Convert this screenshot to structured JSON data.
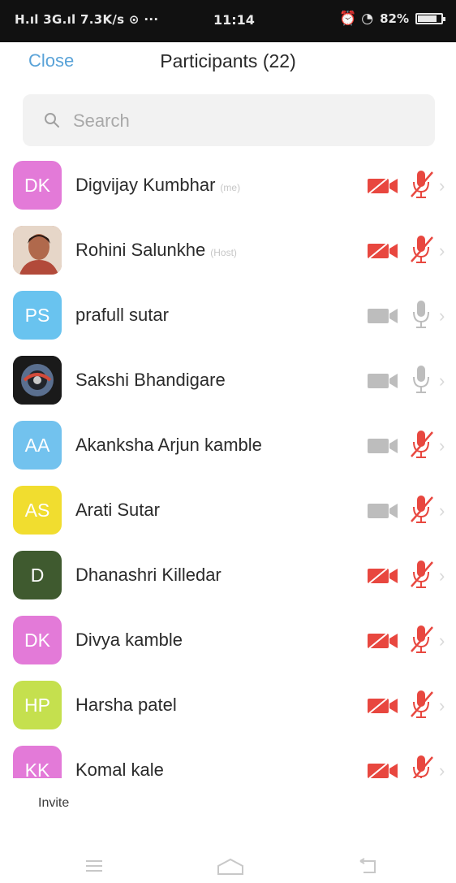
{
  "status_bar": {
    "left": "H.ıl 3G.ıl 7.3K/s ⊙ ···",
    "time": "11:14",
    "battery_text": "82%",
    "battery_level": 0.82
  },
  "header": {
    "close_label": "Close",
    "title": "Participants (22)"
  },
  "search": {
    "placeholder": "Search"
  },
  "participants": [
    {
      "initials": "DK",
      "name": "Digvijay Kumbhar",
      "role": "(me)",
      "avatar_color": "#e37ad8",
      "photo": false,
      "video": "off",
      "audio": "muted"
    },
    {
      "initials": "",
      "name": "Rohini Salunkhe",
      "role": "(Host)",
      "avatar_color": "#c9836b",
      "photo": true,
      "photo_kind": "portrait",
      "video": "off",
      "audio": "muted"
    },
    {
      "initials": "PS",
      "name": "prafull sutar",
      "role": "",
      "avatar_color": "#69c3ef",
      "photo": false,
      "video": "none",
      "audio": "none"
    },
    {
      "initials": "",
      "name": "Sakshi Bhandigare",
      "role": "",
      "avatar_color": "#1d1d1d",
      "photo": true,
      "photo_kind": "logo",
      "video": "none",
      "audio": "none"
    },
    {
      "initials": "AA",
      "name": "Akanksha Arjun kamble",
      "role": "",
      "avatar_color": "#72c2ee",
      "photo": false,
      "video": "none",
      "audio": "muted"
    },
    {
      "initials": "AS",
      "name": "Arati Sutar",
      "role": "",
      "avatar_color": "#f1dd2f",
      "photo": false,
      "video": "none",
      "audio": "muted"
    },
    {
      "initials": "D",
      "name": "Dhanashri Killedar",
      "role": "",
      "avatar_color": "#3f5a2f",
      "photo": false,
      "video": "off",
      "audio": "muted"
    },
    {
      "initials": "DK",
      "name": "Divya kamble",
      "role": "",
      "avatar_color": "#e37ad8",
      "photo": false,
      "video": "off",
      "audio": "muted"
    },
    {
      "initials": "HP",
      "name": "Harsha patel",
      "role": "",
      "avatar_color": "#c5e04e",
      "photo": false,
      "video": "off",
      "audio": "muted"
    },
    {
      "initials": "KK",
      "name": "Komal kale",
      "role": "",
      "avatar_color": "#e37ad8",
      "photo": false,
      "video": "off",
      "audio": "muted"
    }
  ],
  "footer": {
    "invite_label": "Invite"
  },
  "nav": {
    "icons": [
      "menu-icon",
      "home-icon",
      "back-icon"
    ]
  },
  "colors": {
    "accent": "#5aa3d8",
    "muted_red": "#e8473f",
    "inactive_gray": "#bdbdbd"
  }
}
